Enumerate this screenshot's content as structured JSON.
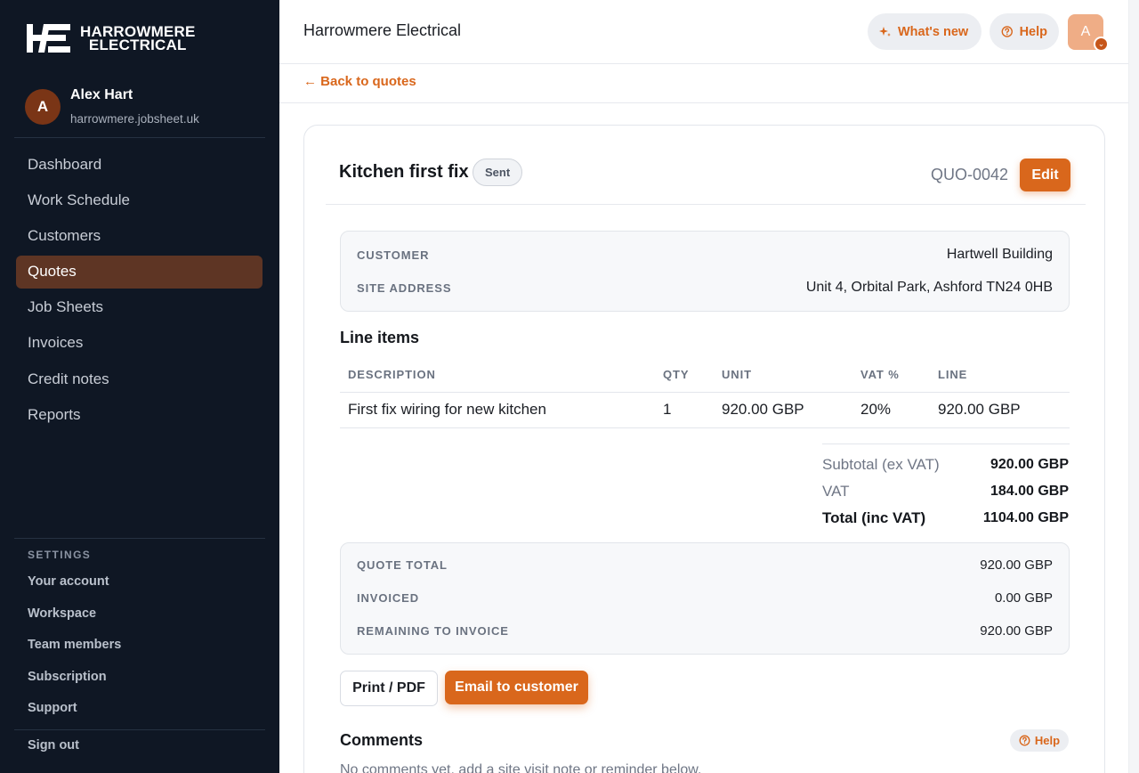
{
  "brand": {
    "line1": "HARROWMERE",
    "line2": "ELECTRICAL",
    "accent": "#d9671c"
  },
  "user": {
    "initial": "A",
    "name": "Alex Hart",
    "domain": "harrowmere.jobsheet.uk"
  },
  "nav": {
    "items": [
      {
        "label": "Dashboard"
      },
      {
        "label": "Work Schedule"
      },
      {
        "label": "Customers"
      },
      {
        "label": "Quotes",
        "active": true
      },
      {
        "label": "Job Sheets"
      },
      {
        "label": "Invoices"
      },
      {
        "label": "Credit notes"
      },
      {
        "label": "Reports"
      }
    ]
  },
  "settings": {
    "label": "SETTINGS",
    "items": [
      {
        "label": "Your account"
      },
      {
        "label": "Workspace"
      },
      {
        "label": "Team members"
      },
      {
        "label": "Subscription"
      },
      {
        "label": "Support"
      }
    ],
    "signout": "Sign out"
  },
  "topbar": {
    "title": "Harrowmere Electrical",
    "whats_new": "What's new",
    "help": "Help",
    "avatar_initial": "A"
  },
  "back_link": "← Back to quotes",
  "quote": {
    "title": "Kitchen first fix",
    "status": "Sent",
    "number": "QUO-0042",
    "edit_label": "Edit",
    "customer_label": "CUSTOMER",
    "customer": "Hartwell Building",
    "site_label": "SITE ADDRESS",
    "site": "Unit 4, Orbital Park, Ashford TN24 0HB"
  },
  "line_items": {
    "title": "Line items",
    "columns": [
      "DESCRIPTION",
      "QTY",
      "UNIT",
      "VAT %",
      "LINE"
    ],
    "rows": [
      [
        "First fix wiring for new kitchen",
        "1",
        "920.00 GBP",
        "20%",
        "920.00 GBP"
      ]
    ]
  },
  "totals": {
    "subtotal_label": "Subtotal (ex VAT)",
    "subtotal": "920.00 GBP",
    "vat_label": "VAT",
    "vat": "184.00 GBP",
    "total_label": "Total (inc VAT)",
    "total": "1104.00 GBP"
  },
  "invoicing": {
    "quote_total_label": "QUOTE TOTAL",
    "quote_total": "920.00 GBP",
    "invoiced_label": "INVOICED",
    "invoiced": "0.00 GBP",
    "remaining_label": "REMAINING TO INVOICE",
    "remaining": "920.00 GBP"
  },
  "actions": {
    "print": "Print / PDF",
    "email": "Email to customer"
  },
  "comments": {
    "title": "Comments",
    "help": "Help",
    "empty": "No comments yet, add a site visit note or reminder below."
  }
}
